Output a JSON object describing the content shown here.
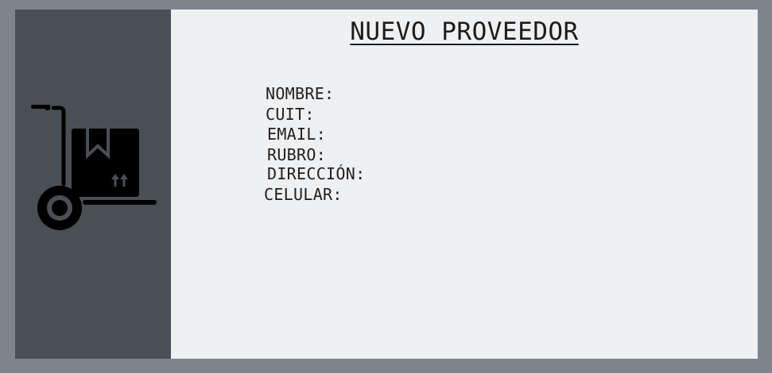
{
  "header": {
    "title": "NUEVO PROVEEDOR"
  },
  "sidebar": {
    "icon": "hand-truck-box-icon"
  },
  "form": {
    "labels": {
      "nombre": "NOMBRE:",
      "cuit": "CUIT:",
      "email": "EMAIL:",
      "rubro": "RUBRO:",
      "direccion": "DIRECCIÓN:",
      "celular": "CELULAR:"
    }
  },
  "colors": {
    "frame": "#7d848c",
    "sidebar": "#4a4f56",
    "panel": "#eff0f2",
    "icon": "#000000"
  }
}
